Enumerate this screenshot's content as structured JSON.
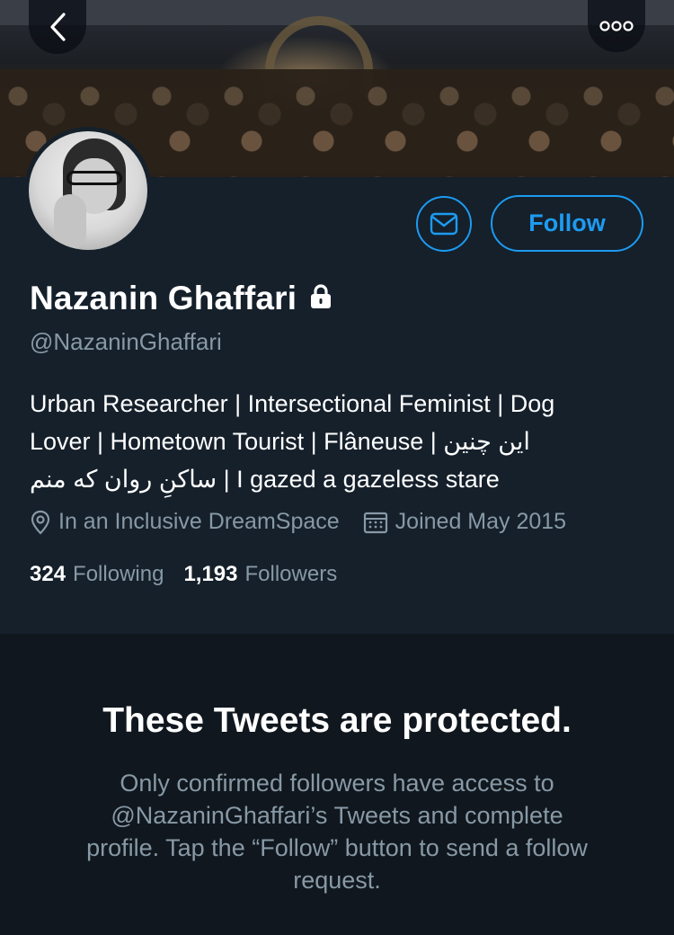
{
  "header": {
    "back_icon": "chevron-left-icon",
    "more_icon": "more-dots-icon",
    "banner_description": "crowd at night banner"
  },
  "profile": {
    "name": "Nazanin Ghaffari",
    "handle": "@NazaninGhaffari",
    "protected_icon": "lock-icon",
    "bio_lines": [
      "Urban Researcher | Intersectional Feminist | Dog",
      "Lover | Hometown Tourist | Flâneuse | این چنین",
      "ساکنِ روان که منم | I gazed a gazeless stare"
    ],
    "location": "In an Inclusive DreamSpace",
    "joined": "Joined May 2015",
    "following_count": "324",
    "following_label": "Following",
    "followers_count": "1,193",
    "followers_label": "Followers"
  },
  "actions": {
    "follow_label": "Follow",
    "message_icon": "envelope-icon"
  },
  "protected_notice": {
    "title": "These Tweets are protected.",
    "body": "Only confirmed followers have access to @NazaninGhaffari’s Tweets and complete profile. Tap the “Follow” button to send a follow request."
  },
  "colors": {
    "background": "#15202b",
    "accent": "#1d9bf0",
    "secondary_text": "#8899a6"
  }
}
